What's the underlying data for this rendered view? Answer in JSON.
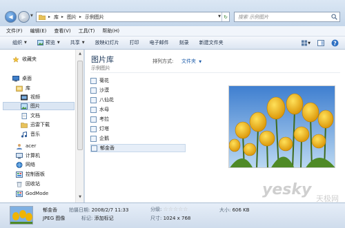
{
  "address": {
    "crumbs": [
      "库",
      "图片",
      "示例图片"
    ],
    "search_placeholder": "搜索 示例图片"
  },
  "menu": [
    "文件(F)",
    "编辑(E)",
    "查看(V)",
    "工具(T)",
    "帮助(H)"
  ],
  "toolbar": {
    "organize": "组织",
    "preview": "预览",
    "share": "共享",
    "slideshow": "放映幻灯片",
    "print": "打印",
    "email": "电子邮件",
    "burn": "刻录",
    "new_folder": "新建文件夹"
  },
  "nav": {
    "favorites": "收藏夹",
    "desktop": "桌面",
    "libraries": "库",
    "videos": "视频",
    "pictures": "图片",
    "documents": "文档",
    "thunder": "迅雷下载",
    "music": "音乐",
    "acer": "acer",
    "computer": "计算机",
    "network": "网络",
    "control_panel": "控制面板",
    "recycle_bin": "回收站",
    "godmode": "GodMode"
  },
  "content": {
    "title": "图片库",
    "subtitle": "示例图片",
    "arrange_label": "排列方式:",
    "arrange_value": "文件夹",
    "files": [
      "菊花",
      "沙漠",
      "八仙花",
      "水母",
      "考拉",
      "灯塔",
      "企鹅",
      "郁金香"
    ],
    "selected_file": "郁金香"
  },
  "details": {
    "name": "郁金香",
    "type": "JPEG 图像",
    "date_label": "拍摄日期:",
    "date_value": "2008/2/7 11:33",
    "tags_label": "标记:",
    "tags_value": "添加标记",
    "rating_label": "分级:",
    "rating": 0,
    "dims_label": "尺寸:",
    "dims_value": "1024 x 768",
    "size_label": "大小:",
    "size_value": "606 KB"
  },
  "watermark": {
    "brand": "yesky",
    "cn": "天极网"
  },
  "colors": {
    "accent": "#1a5aa8",
    "tulip_yellow": "#f2b705",
    "sky_blue": "#4f8fd4"
  }
}
